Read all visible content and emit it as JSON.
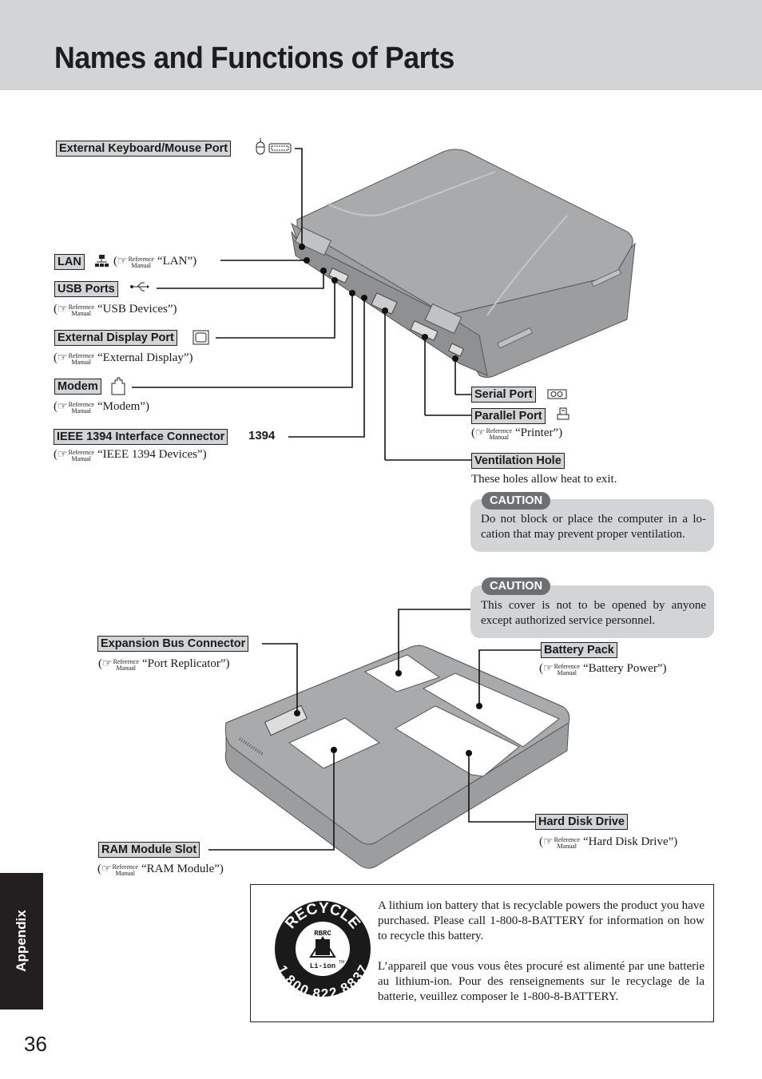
{
  "page": {
    "title": "Names and Functions of Parts",
    "section_tab": "Appendix",
    "page_number": "36"
  },
  "reference_mark": {
    "line1": "Reference",
    "line2": "Manual",
    "icon": "pointing-hand-icon"
  },
  "top_view": {
    "parts": [
      {
        "id": "keyboard-mouse",
        "label": "External Keyboard/Mouse Port",
        "icons": [
          "mouse-icon",
          "keyboard-icon"
        ],
        "reference": ""
      },
      {
        "id": "lan",
        "label": "LAN",
        "icons": [
          "lan-icon"
        ],
        "reference": "“LAN”"
      },
      {
        "id": "usb",
        "label": "USB Ports",
        "icons": [
          "usb-icon"
        ],
        "reference": "“USB Devices”"
      },
      {
        "id": "display",
        "label": "External Display Port",
        "icons": [
          "monitor-icon"
        ],
        "reference": "“External Display”"
      },
      {
        "id": "modem",
        "label": "Modem",
        "icons": [
          "phone-jack-icon"
        ],
        "reference": "“Modem”"
      },
      {
        "id": "ieee1394",
        "label": "IEEE 1394 Interface Connector",
        "icons": [
          "ieee1394-icon"
        ],
        "icon_text": "1394",
        "reference": "“IEEE 1394 Devices”"
      },
      {
        "id": "serial",
        "label": "Serial Port",
        "icons": [
          "serial-port-icon"
        ],
        "reference": ""
      },
      {
        "id": "parallel",
        "label": "Parallel Port",
        "icons": [
          "printer-icon"
        ],
        "reference": "“Printer”"
      },
      {
        "id": "ventilation",
        "label": "Ventilation Hole",
        "icons": [],
        "reference": ""
      }
    ],
    "ventilation_note": "These holes allow heat to exit.",
    "caution": {
      "badge": "CAUTION",
      "text": "Do not block or place the computer in a lo-cation that may prevent proper ventilation."
    }
  },
  "bottom_view": {
    "caution": {
      "badge": "CAUTION",
      "text": "This cover is not to be opened by anyone except authorized service personnel."
    },
    "parts": [
      {
        "id": "expansion",
        "label": "Expansion Bus Connector",
        "reference": "“Port Replicator”"
      },
      {
        "id": "battery",
        "label": "Battery Pack",
        "reference": "“Battery Power”"
      },
      {
        "id": "hdd",
        "label": "Hard Disk Drive",
        "reference": "“Hard Disk Drive”"
      },
      {
        "id": "ram",
        "label": "RAM Module Slot",
        "reference": "“RAM Module”"
      }
    ]
  },
  "recycle": {
    "logo": {
      "top": "RECYCLE",
      "middle": "RBRC",
      "bottom": "Li-ion",
      "phone": "1.800.822.8837",
      "tm": "TM"
    },
    "english": "A lithium ion battery that is recyclable powers the product you have purchased.  Please call 1-800-8-BATTERY for information on how to recycle this battery.",
    "french": "L’appareil que vous vous êtes procuré est alimenté par une batterie au lithium-ion. Pour des renseignements sur le recyclage de la batterie, veuillez composer le 1-800-8-BATTERY."
  },
  "colors": {
    "header_band": "#d3d4d6",
    "label_fill": "#d3d4d6",
    "caution_badge": "#6e6f71",
    "side_tab": "#231f20",
    "laptop_body": "#a9aaac"
  }
}
